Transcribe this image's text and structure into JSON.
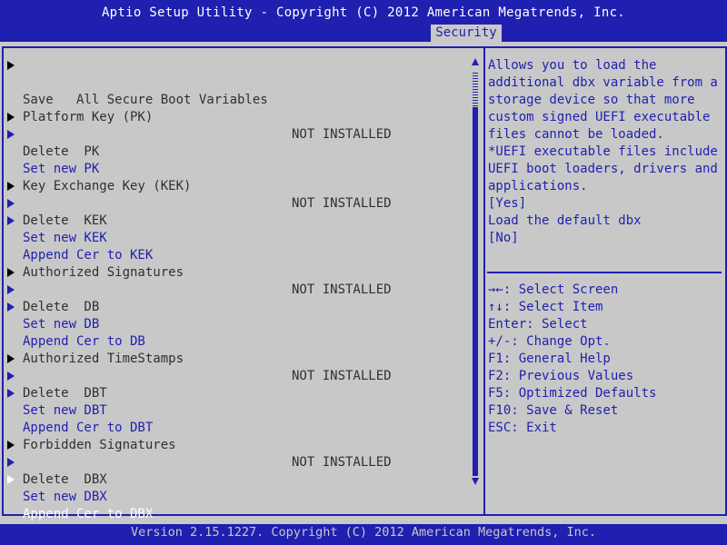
{
  "header": {
    "title": "Aptio Setup Utility - Copyright (C) 2012 American Megatrends, Inc.",
    "active_tab": "Security"
  },
  "menu": {
    "save_all": "Save   All Secure Boot Variables",
    "pk": {
      "label": "Platform Key (PK)",
      "status": "NOT INSTALLED",
      "delete": "Delete  PK",
      "set_new": "Set new PK"
    },
    "kek": {
      "label": "Key Exchange Key (KEK)",
      "status": "NOT INSTALLED",
      "delete": "Delete  KEK",
      "set_new": "Set new KEK",
      "append": "Append Cer to KEK"
    },
    "db": {
      "label": "Authorized Signatures",
      "status": "NOT INSTALLED",
      "delete": "Delete  DB",
      "set_new": "Set new DB",
      "append": "Append Cer to DB"
    },
    "dbt": {
      "label": "Authorized TimeStamps",
      "status": "NOT INSTALLED",
      "delete": "Delete  DBT",
      "set_new": "Set new DBT",
      "append": "Append Cer to DBT"
    },
    "dbx": {
      "label": "Forbidden Signatures",
      "status": "NOT INSTALLED",
      "delete": "Delete  DBX",
      "set_new": "Set new DBX",
      "append": "Append Cer to DBX"
    }
  },
  "help": {
    "lines": [
      "Allows you to load the",
      "additional dbx variable from a",
      "storage device so that more",
      "custom signed UEFI executable",
      "files cannot be loaded.",
      "*UEFI executable files include",
      "UEFI boot loaders, drivers and",
      "applications.",
      "[Yes]",
      "Load the default dbx",
      "[No]"
    ]
  },
  "keys": [
    "→←: Select Screen",
    "↑↓: Select Item",
    "Enter: Select",
    "+/-: Change Opt.",
    "F1: General Help",
    "F2: Previous Values",
    "F5: Optimized Defaults",
    "F10: Save & Reset",
    "ESC: Exit"
  ],
  "footer": "Version 2.15.1227. Copyright (C) 2012 American Megatrends, Inc.",
  "colors": {
    "bios_blue": "#1f1fb0",
    "panel_gray": "#c8c8c8",
    "selected_white": "#ffffff"
  }
}
